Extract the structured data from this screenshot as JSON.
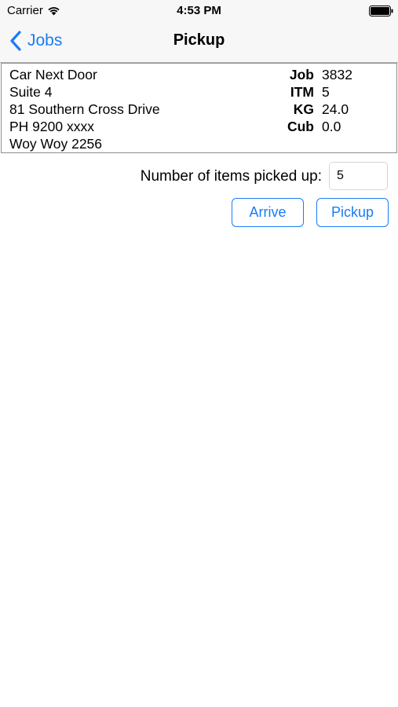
{
  "status_bar": {
    "carrier": "Carrier",
    "time": "4:53 PM",
    "wifi_icon": "wifi-icon",
    "battery_icon": "battery-full-icon"
  },
  "nav": {
    "back_label": "Jobs",
    "back_icon": "chevron-left-icon",
    "title": "Pickup"
  },
  "job": {
    "address_lines": [
      "Car Next Door",
      "Suite 4",
      "81 Southern Cross Drive",
      "PH 9200 xxxx",
      "Woy Woy 2256"
    ],
    "stats": [
      {
        "label": "Job",
        "value": "3832"
      },
      {
        "label": "ITM",
        "value": "5"
      },
      {
        "label": "KG",
        "value": "24.0"
      },
      {
        "label": "Cub",
        "value": "0.0"
      }
    ]
  },
  "pickup_count": {
    "label": "Number of items picked up:",
    "value": "5"
  },
  "actions": {
    "arrive_label": "Arrive",
    "pickup_label": "Pickup"
  },
  "colors": {
    "accent": "#1a7cf5",
    "nav_background": "#f7f7f7",
    "card_border": "#8e8e8e"
  }
}
